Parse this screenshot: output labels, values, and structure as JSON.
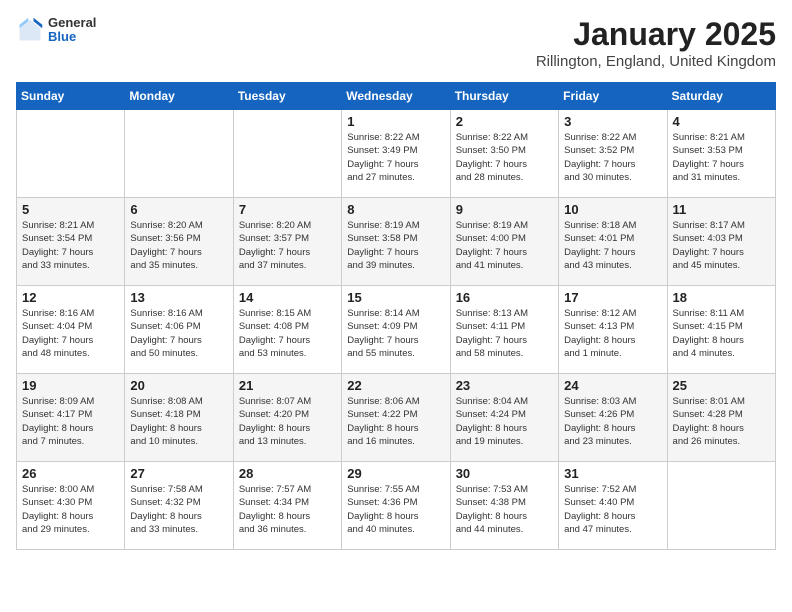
{
  "header": {
    "logo_general": "General",
    "logo_blue": "Blue",
    "month_title": "January 2025",
    "location": "Rillington, England, United Kingdom"
  },
  "weekdays": [
    "Sunday",
    "Monday",
    "Tuesday",
    "Wednesday",
    "Thursday",
    "Friday",
    "Saturday"
  ],
  "weeks": [
    [
      {
        "day": "",
        "info": ""
      },
      {
        "day": "",
        "info": ""
      },
      {
        "day": "",
        "info": ""
      },
      {
        "day": "1",
        "info": "Sunrise: 8:22 AM\nSunset: 3:49 PM\nDaylight: 7 hours\nand 27 minutes."
      },
      {
        "day": "2",
        "info": "Sunrise: 8:22 AM\nSunset: 3:50 PM\nDaylight: 7 hours\nand 28 minutes."
      },
      {
        "day": "3",
        "info": "Sunrise: 8:22 AM\nSunset: 3:52 PM\nDaylight: 7 hours\nand 30 minutes."
      },
      {
        "day": "4",
        "info": "Sunrise: 8:21 AM\nSunset: 3:53 PM\nDaylight: 7 hours\nand 31 minutes."
      }
    ],
    [
      {
        "day": "5",
        "info": "Sunrise: 8:21 AM\nSunset: 3:54 PM\nDaylight: 7 hours\nand 33 minutes."
      },
      {
        "day": "6",
        "info": "Sunrise: 8:20 AM\nSunset: 3:56 PM\nDaylight: 7 hours\nand 35 minutes."
      },
      {
        "day": "7",
        "info": "Sunrise: 8:20 AM\nSunset: 3:57 PM\nDaylight: 7 hours\nand 37 minutes."
      },
      {
        "day": "8",
        "info": "Sunrise: 8:19 AM\nSunset: 3:58 PM\nDaylight: 7 hours\nand 39 minutes."
      },
      {
        "day": "9",
        "info": "Sunrise: 8:19 AM\nSunset: 4:00 PM\nDaylight: 7 hours\nand 41 minutes."
      },
      {
        "day": "10",
        "info": "Sunrise: 8:18 AM\nSunset: 4:01 PM\nDaylight: 7 hours\nand 43 minutes."
      },
      {
        "day": "11",
        "info": "Sunrise: 8:17 AM\nSunset: 4:03 PM\nDaylight: 7 hours\nand 45 minutes."
      }
    ],
    [
      {
        "day": "12",
        "info": "Sunrise: 8:16 AM\nSunset: 4:04 PM\nDaylight: 7 hours\nand 48 minutes."
      },
      {
        "day": "13",
        "info": "Sunrise: 8:16 AM\nSunset: 4:06 PM\nDaylight: 7 hours\nand 50 minutes."
      },
      {
        "day": "14",
        "info": "Sunrise: 8:15 AM\nSunset: 4:08 PM\nDaylight: 7 hours\nand 53 minutes."
      },
      {
        "day": "15",
        "info": "Sunrise: 8:14 AM\nSunset: 4:09 PM\nDaylight: 7 hours\nand 55 minutes."
      },
      {
        "day": "16",
        "info": "Sunrise: 8:13 AM\nSunset: 4:11 PM\nDaylight: 7 hours\nand 58 minutes."
      },
      {
        "day": "17",
        "info": "Sunrise: 8:12 AM\nSunset: 4:13 PM\nDaylight: 8 hours\nand 1 minute."
      },
      {
        "day": "18",
        "info": "Sunrise: 8:11 AM\nSunset: 4:15 PM\nDaylight: 8 hours\nand 4 minutes."
      }
    ],
    [
      {
        "day": "19",
        "info": "Sunrise: 8:09 AM\nSunset: 4:17 PM\nDaylight: 8 hours\nand 7 minutes."
      },
      {
        "day": "20",
        "info": "Sunrise: 8:08 AM\nSunset: 4:18 PM\nDaylight: 8 hours\nand 10 minutes."
      },
      {
        "day": "21",
        "info": "Sunrise: 8:07 AM\nSunset: 4:20 PM\nDaylight: 8 hours\nand 13 minutes."
      },
      {
        "day": "22",
        "info": "Sunrise: 8:06 AM\nSunset: 4:22 PM\nDaylight: 8 hours\nand 16 minutes."
      },
      {
        "day": "23",
        "info": "Sunrise: 8:04 AM\nSunset: 4:24 PM\nDaylight: 8 hours\nand 19 minutes."
      },
      {
        "day": "24",
        "info": "Sunrise: 8:03 AM\nSunset: 4:26 PM\nDaylight: 8 hours\nand 23 minutes."
      },
      {
        "day": "25",
        "info": "Sunrise: 8:01 AM\nSunset: 4:28 PM\nDaylight: 8 hours\nand 26 minutes."
      }
    ],
    [
      {
        "day": "26",
        "info": "Sunrise: 8:00 AM\nSunset: 4:30 PM\nDaylight: 8 hours\nand 29 minutes."
      },
      {
        "day": "27",
        "info": "Sunrise: 7:58 AM\nSunset: 4:32 PM\nDaylight: 8 hours\nand 33 minutes."
      },
      {
        "day": "28",
        "info": "Sunrise: 7:57 AM\nSunset: 4:34 PM\nDaylight: 8 hours\nand 36 minutes."
      },
      {
        "day": "29",
        "info": "Sunrise: 7:55 AM\nSunset: 4:36 PM\nDaylight: 8 hours\nand 40 minutes."
      },
      {
        "day": "30",
        "info": "Sunrise: 7:53 AM\nSunset: 4:38 PM\nDaylight: 8 hours\nand 44 minutes."
      },
      {
        "day": "31",
        "info": "Sunrise: 7:52 AM\nSunset: 4:40 PM\nDaylight: 8 hours\nand 47 minutes."
      },
      {
        "day": "",
        "info": ""
      }
    ]
  ]
}
